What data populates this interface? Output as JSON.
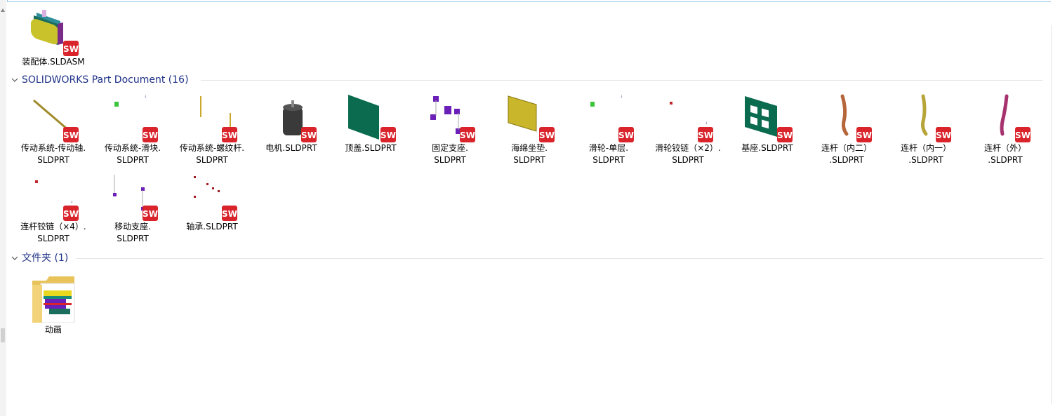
{
  "top_items": [
    {
      "name": "装配体.SLDASM",
      "kind": "assembly"
    }
  ],
  "groups": [
    {
      "title": "SOLIDWORKS Part Document (16)",
      "items": [
        {
          "line1": "传动系统-传动轴.",
          "line2": "SLDPRT",
          "kind": "shaft"
        },
        {
          "line1": "传动系统-滑块.",
          "line2": "SLDPRT",
          "kind": "greenbit"
        },
        {
          "line1": "传动系统-螺纹杆.",
          "line2": "SLDPRT",
          "kind": "rods"
        },
        {
          "line1": "电机.SLDPRT",
          "line2": "",
          "kind": "motor"
        },
        {
          "line1": "顶盖.SLDPRT",
          "line2": "",
          "kind": "plate"
        },
        {
          "line1": "固定支座.",
          "line2": "SLDPRT",
          "kind": "purple"
        },
        {
          "line1": "海绵坐垫.",
          "line2": "SLDPRT",
          "kind": "cushion"
        },
        {
          "line1": "滑轮-单层.",
          "line2": "SLDPRT",
          "kind": "greenbit"
        },
        {
          "line1": "滑轮铰链（×2）.",
          "line2": "SLDPRT",
          "kind": "redbit"
        },
        {
          "line1": "基座.SLDPRT",
          "line2": "",
          "kind": "base"
        },
        {
          "line1": "连杆（内二）",
          "line2": ".SLDPRT",
          "kind": "link-brown"
        },
        {
          "line1": "连杆（内一）",
          "line2": ".SLDPRT",
          "kind": "link-olive"
        },
        {
          "line1": "连杆（外）",
          "line2": ".SLDPRT",
          "kind": "link-magenta"
        },
        {
          "line1": "连杆铰链（×4）.",
          "line2": "SLDPRT",
          "kind": "redbit"
        },
        {
          "line1": "移动支座.",
          "line2": "SLDPRT",
          "kind": "purple2"
        },
        {
          "line1": "轴承.SLDPRT",
          "line2": "",
          "kind": "bearing"
        }
      ]
    },
    {
      "title": "文件夹 (1)",
      "items": [
        {
          "line1": "动画",
          "line2": "",
          "kind": "folder"
        }
      ]
    }
  ],
  "badge_text": "SW",
  "colors": {
    "group_title": "#1e3287",
    "badge_red": "#d9242b",
    "shaft": "#a08a2a",
    "plate_green": "#0a6b4f",
    "cushion": "#c9b62a",
    "motor": "#3a3a3a",
    "purple": "#6a1fb8",
    "link_brown": "#b5663a",
    "link_olive": "#b8a53a",
    "link_magenta": "#a6336e"
  }
}
